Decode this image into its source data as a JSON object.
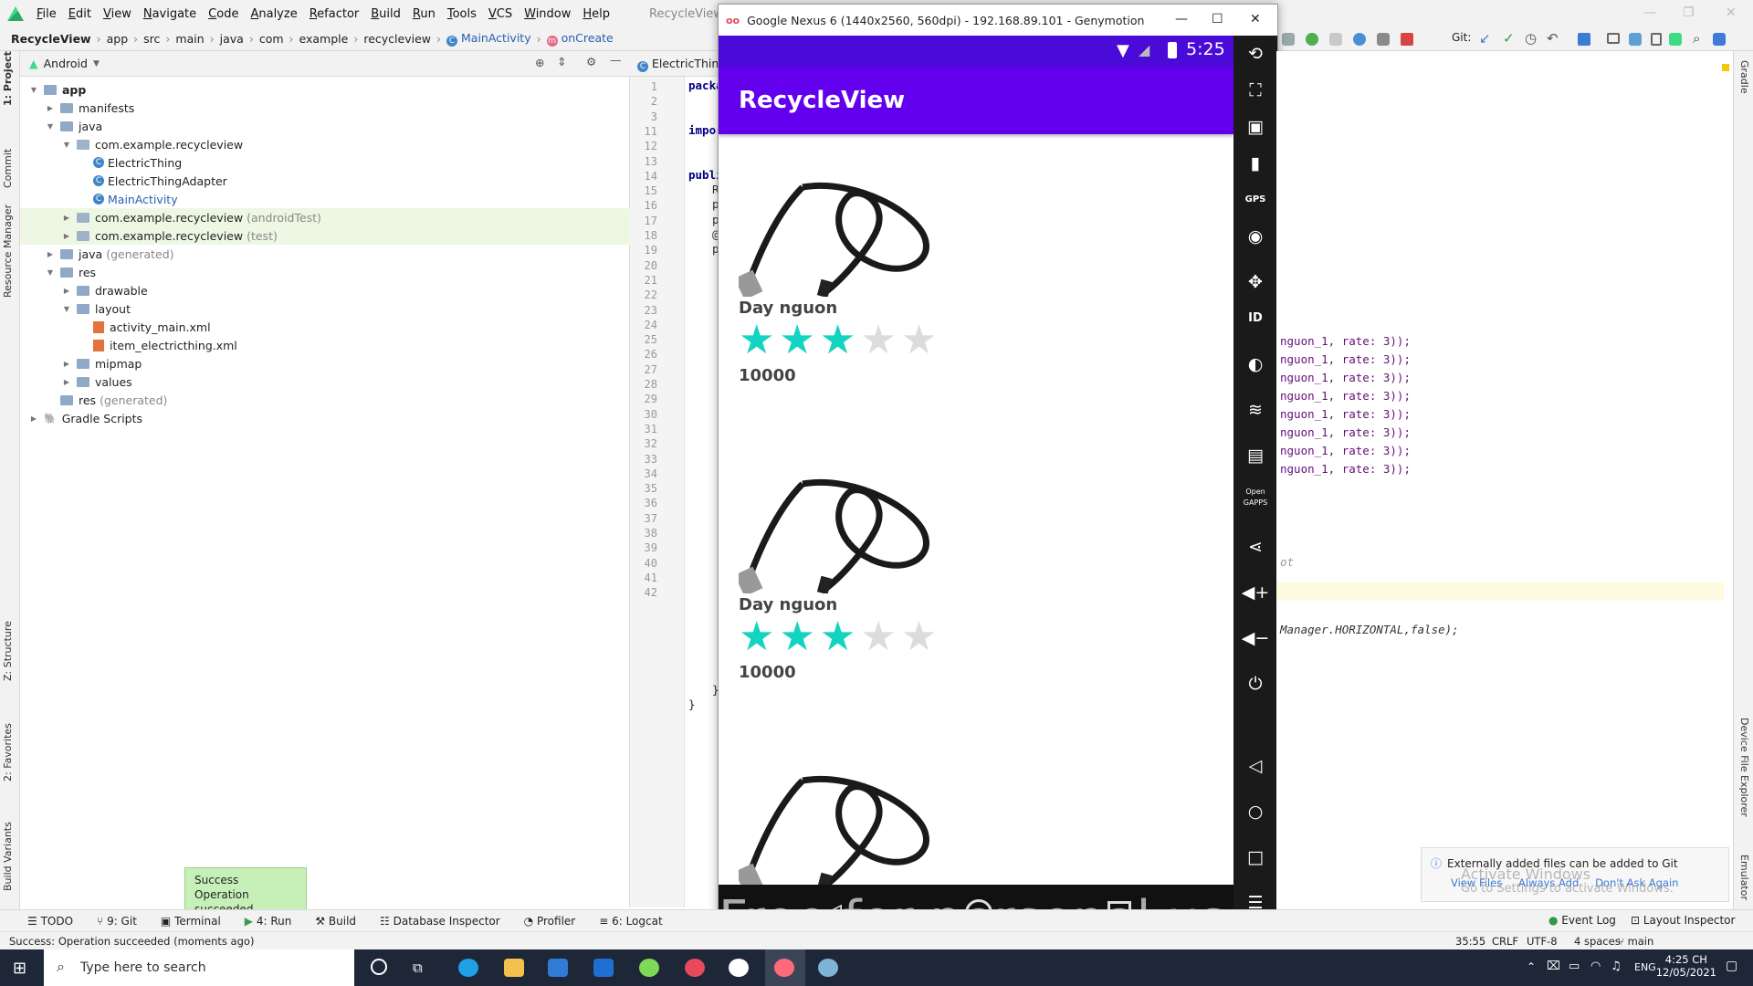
{
  "menu": {
    "items": [
      "File",
      "Edit",
      "View",
      "Navigate",
      "Code",
      "Analyze",
      "Refactor",
      "Build",
      "Run",
      "Tools",
      "VCS",
      "Window",
      "Help"
    ],
    "title_fragment": "RecycleView - MainActivity.java [R"
  },
  "navbar": {
    "crumbs": [
      "RecycleView",
      "app",
      "src",
      "main",
      "java",
      "com",
      "example",
      "recycleview"
    ],
    "class_crumb": "MainActivity",
    "method_crumb": "onCreate",
    "git_label": "Git:"
  },
  "left_tabs": [
    "1: Project",
    "Commit",
    "Resource Manager",
    "Z: Structure",
    "2: Favorites",
    "Build Variants"
  ],
  "right_tabs": [
    "Gradle",
    "Device File Explorer",
    "Emulator"
  ],
  "project": {
    "view_label": "Android",
    "tree": [
      {
        "label": "app",
        "kind": "module",
        "indent": 0,
        "open": true
      },
      {
        "label": "manifests",
        "kind": "folder",
        "indent": 1,
        "open": false
      },
      {
        "label": "java",
        "kind": "folder",
        "indent": 1,
        "open": true
      },
      {
        "label": "com.example.recycleview",
        "kind": "package",
        "indent": 2,
        "open": true
      },
      {
        "label": "ElectricThing",
        "kind": "class",
        "indent": 3
      },
      {
        "label": "ElectricThingAdapter",
        "kind": "class",
        "indent": 3
      },
      {
        "label": "MainActivity",
        "kind": "class",
        "indent": 3,
        "selected": true
      },
      {
        "label": "com.example.recycleview",
        "suffix": "(androidTest)",
        "kind": "package",
        "indent": 2,
        "open": false,
        "hl": true
      },
      {
        "label": "com.example.recycleview",
        "suffix": "(test)",
        "kind": "package",
        "indent": 2,
        "open": false,
        "hl": true
      },
      {
        "label": "java",
        "suffix": "(generated)",
        "kind": "folder",
        "indent": 1,
        "open": false
      },
      {
        "label": "res",
        "kind": "folder",
        "indent": 1,
        "open": true
      },
      {
        "label": "drawable",
        "kind": "folder",
        "indent": 2,
        "open": false
      },
      {
        "label": "layout",
        "kind": "folder",
        "indent": 2,
        "open": true
      },
      {
        "label": "activity_main.xml",
        "kind": "xml",
        "indent": 3
      },
      {
        "label": "item_electricthing.xml",
        "kind": "xml",
        "indent": 3
      },
      {
        "label": "mipmap",
        "kind": "folder",
        "indent": 2,
        "open": false
      },
      {
        "label": "values",
        "kind": "folder",
        "indent": 2,
        "open": false
      },
      {
        "label": "res",
        "suffix": "(generated)",
        "kind": "folder",
        "indent": 1
      },
      {
        "label": "Gradle Scripts",
        "kind": "gradle",
        "indent": 0,
        "open": false
      }
    ]
  },
  "editor": {
    "tab_label": "ElectricThing",
    "line_numbers": [
      "1",
      "2",
      "3",
      "11",
      "12",
      "13",
      "14",
      "15",
      "16",
      "17",
      "18",
      "19",
      "20",
      "21",
      "22",
      "23",
      "24",
      "25",
      "26",
      "27",
      "28",
      "29",
      "30",
      "31",
      "32",
      "33",
      "34",
      "35",
      "36",
      "37",
      "38",
      "39",
      "40",
      "41",
      "42"
    ],
    "left_code": [
      "packa",
      "",
      "impor",
      "",
      "publi",
      "R",
      "p",
      "p",
      "@",
      "p"
    ],
    "closing_brace_inner": "}",
    "closing_brace_outer": "}",
    "right_code_lines": [
      "nguon_1, rate: 3));",
      "nguon_1, rate: 3));",
      "nguon_1, rate: 3));",
      "nguon_1, rate: 3));",
      "nguon_1, rate: 3));",
      "nguon_1, rate: 3));",
      "nguon_1, rate: 3));",
      "nguon_1, rate: 3));"
    ],
    "right_comment": "ot",
    "right_manager_line": "Manager.HORIZONTAL,false);"
  },
  "emulator": {
    "window_title": "Google Nexus 6 (1440x2560, 560dpi) - 192.168.89.101 - Genymotion",
    "time": "5:25",
    "app_title": "RecycleView",
    "items": [
      {
        "name": "Day nguon",
        "rating": 3,
        "max_rating": 5,
        "price": "10000"
      },
      {
        "name": "Day nguon",
        "rating": 3,
        "max_rating": 5,
        "price": "10000"
      },
      {
        "name": "",
        "rating": 3,
        "max_rating": 5,
        "price": ""
      }
    ],
    "watermark": "Free for personal use",
    "side_labels": {
      "gps": "GPS",
      "opengapps": "Open GAPPS",
      "id": "ID"
    }
  },
  "toast": {
    "title": "Success",
    "message": "Operation succeeded"
  },
  "notification": {
    "text": "Externally added files can be added to Git",
    "links": [
      "View Files",
      "Always Add",
      "Don't Ask Again"
    ]
  },
  "activate": {
    "line1": "Activate Windows",
    "line2": "Go to Settings to activate Windows."
  },
  "bottom_tools": [
    "TODO",
    "9: Git",
    "Terminal",
    "4: Run",
    "Build",
    "Database Inspector",
    "Profiler",
    "6: Logcat"
  ],
  "bottom_right_tools": [
    "Event Log",
    "Layout Inspector"
  ],
  "status": {
    "message": "Success: Operation succeeded (moments ago)",
    "position": "35:55",
    "line_sep": "CRLF",
    "encoding": "UTF-8",
    "indent": "4 spaces",
    "branch": "main"
  },
  "taskbar": {
    "search_placeholder": "Type here to search",
    "lang": "ENG",
    "time": "4:25 CH",
    "date": "12/05/2021"
  },
  "colors": {
    "appbar": "#6200ee",
    "statusbar": "#4a0ad8",
    "star_on": "#12d4c0",
    "star_off": "#dcdcdc",
    "toast_bg": "#c7f0b9"
  }
}
